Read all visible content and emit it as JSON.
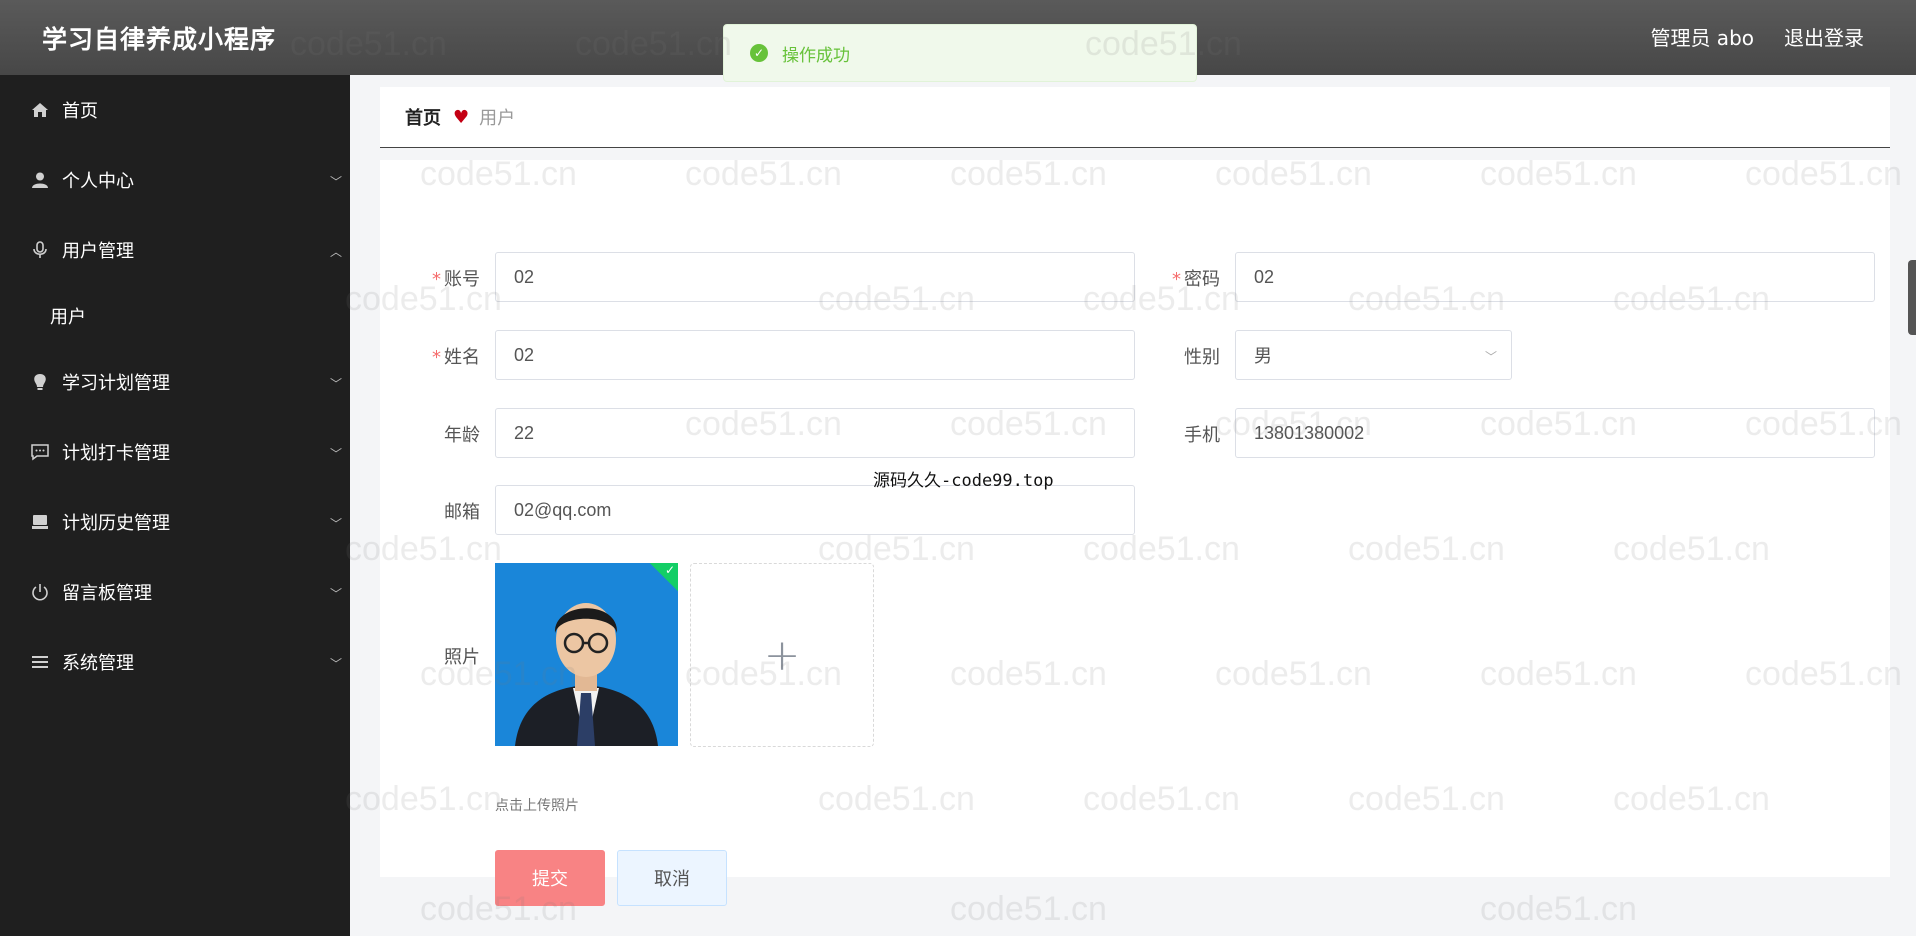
{
  "header": {
    "app_title": "学习自律养成小程序",
    "admin_label": "管理员 abo",
    "logout_label": "退出登录"
  },
  "toast": {
    "icon": "success-check-icon",
    "message": "操作成功"
  },
  "sidebar": {
    "items": [
      {
        "label": "首页",
        "icon": "home-icon"
      },
      {
        "label": "个人中心",
        "icon": "user-icon"
      },
      {
        "label": "用户管理",
        "icon": "microphone-icon",
        "expanded": true,
        "children": [
          {
            "label": "用户"
          }
        ]
      },
      {
        "label": "学习计划管理",
        "icon": "bulb-icon"
      },
      {
        "label": "计划打卡管理",
        "icon": "chat-icon"
      },
      {
        "label": "计划历史管理",
        "icon": "monitor-icon"
      },
      {
        "label": "留言板管理",
        "icon": "power-icon"
      },
      {
        "label": "系统管理",
        "icon": "list-icon"
      }
    ]
  },
  "breadcrumb": {
    "home": "首页",
    "current": "用户"
  },
  "form": {
    "account": {
      "label": "账号",
      "value": "02",
      "required": true
    },
    "password": {
      "label": "密码",
      "value": "02",
      "required": true
    },
    "name": {
      "label": "姓名",
      "value": "02",
      "required": true
    },
    "gender": {
      "label": "性别",
      "value": "男"
    },
    "age": {
      "label": "年龄",
      "value": "22"
    },
    "phone": {
      "label": "手机",
      "value": "13801380002"
    },
    "email": {
      "label": "邮箱",
      "value": "02@qq.com"
    },
    "photo": {
      "label": "照片",
      "tip": "点击上传照片"
    },
    "submit_label": "提交",
    "cancel_label": "取消"
  },
  "source_tag": "源码久久-code99.top",
  "watermark_text": "code51.cn",
  "colors": {
    "header": "#4f4f4f",
    "sidebar": "#1f1f1f",
    "submit": "#f88384",
    "required": "#f56c6c",
    "success": "#67c23a"
  }
}
